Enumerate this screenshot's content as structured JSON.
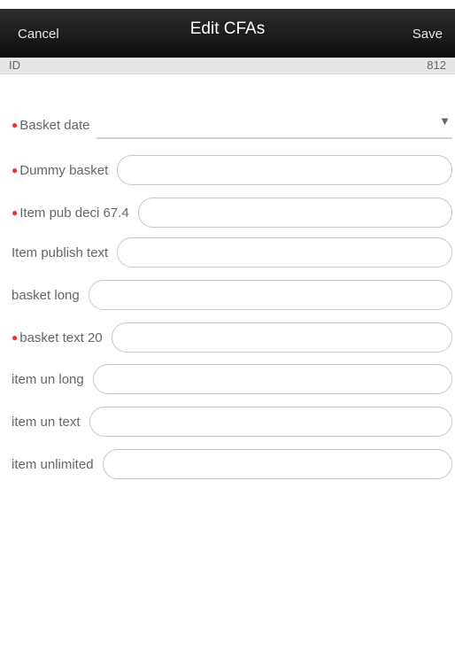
{
  "header": {
    "cancel_label": "Cancel",
    "title": "Edit CFAs",
    "save_label": "Save"
  },
  "id_row": {
    "label": "ID",
    "value": "812"
  },
  "fields": [
    {
      "label": "Basket date",
      "required": true,
      "type": "select",
      "value": ""
    },
    {
      "label": "Dummy basket",
      "required": true,
      "type": "text",
      "value": ""
    },
    {
      "label": "Item pub deci 67.4",
      "required": true,
      "type": "text",
      "value": ""
    },
    {
      "label": "Item publish text",
      "required": false,
      "type": "text",
      "value": ""
    },
    {
      "label": "basket long",
      "required": false,
      "type": "text",
      "value": ""
    },
    {
      "label": "basket text 20",
      "required": true,
      "type": "text",
      "value": ""
    },
    {
      "label": "item un long",
      "required": false,
      "type": "text",
      "value": ""
    },
    {
      "label": "item un text",
      "required": false,
      "type": "text",
      "value": ""
    },
    {
      "label": "item unlimited",
      "required": false,
      "type": "text",
      "value": ""
    }
  ],
  "icons": {
    "required_marker": "required-dot-icon",
    "dropdown": "triangle-down-icon"
  },
  "colors": {
    "header_bg": "#111111",
    "required": "#e53935",
    "id_row_bg": "#e6e6e6"
  }
}
